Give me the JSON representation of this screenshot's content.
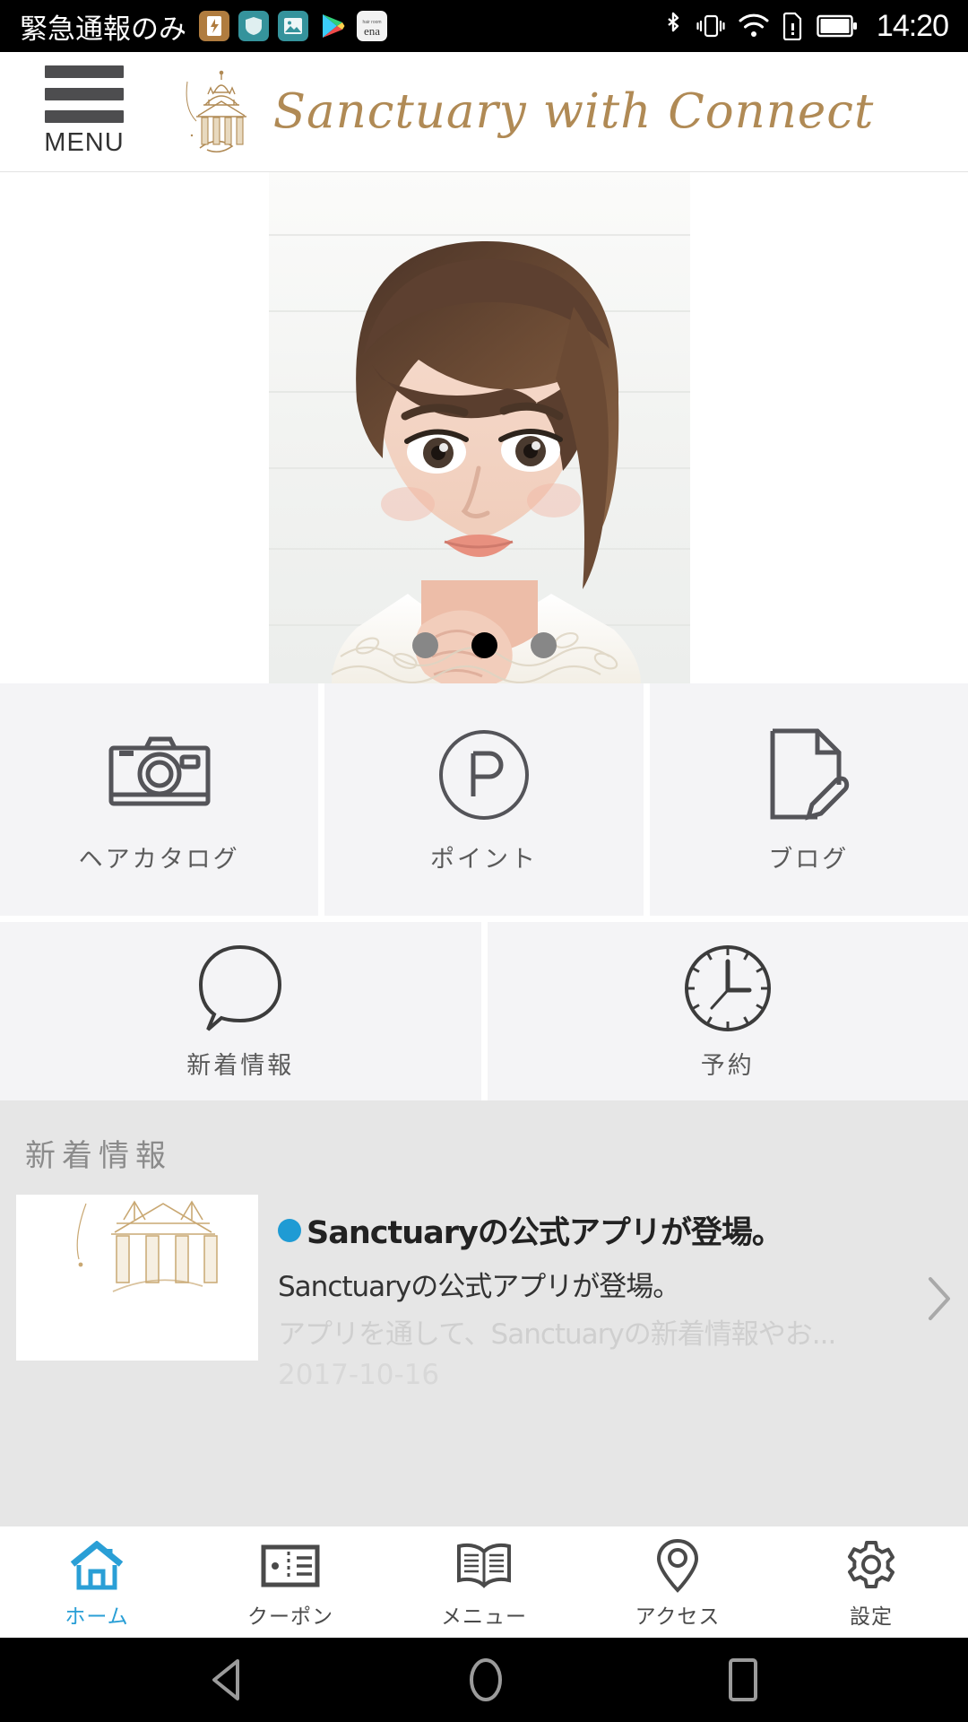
{
  "statusbar": {
    "carrier": "緊急通報のみ",
    "time": "14:20",
    "left_icons": [
      "battery-saver-icon",
      "shield-icon",
      "gallery-icon",
      "play-store-icon",
      "ena-app-icon"
    ],
    "right_icons": [
      "bluetooth-icon",
      "vibrate-icon",
      "wifi-icon",
      "sd-card-icon",
      "battery-icon"
    ]
  },
  "header": {
    "menu_label": "MENU",
    "logo_text": "Sanctuary with Connect",
    "logo_color": "#b08a55"
  },
  "hero": {
    "alt": "woman-with-short-brown-hair-portrait",
    "dots": [
      {
        "active": false
      },
      {
        "active": true
      },
      {
        "active": false
      }
    ]
  },
  "tiles": {
    "row1": [
      {
        "label": "ヘアカタログ",
        "icon": "camera-icon"
      },
      {
        "label": "ポイント",
        "icon": "point-p-circle-icon"
      },
      {
        "label": "ブログ",
        "icon": "document-pencil-icon"
      }
    ],
    "row2": [
      {
        "label": "新着情報",
        "icon": "speech-bubble-icon"
      },
      {
        "label": "予約",
        "icon": "clock-icon"
      }
    ]
  },
  "news": {
    "section_title": "新着情報",
    "items": [
      {
        "bullet_color": "#1f9bd4",
        "title": "Sanctuaryの公式アプリが登場。",
        "subtitle": "Sanctuaryの公式アプリが登場。",
        "subtitle2": "アプリを通して、Sanctuaryの新着情報やお...",
        "date": "2017-10-16",
        "thumb_alt": "sanctuary-temple-logo-thumbnail"
      }
    ]
  },
  "tabbar": {
    "active_color": "#2a9fd6",
    "items": [
      {
        "label": "ホーム",
        "icon": "home-icon",
        "active": true
      },
      {
        "label": "クーポン",
        "icon": "coupon-ticket-icon",
        "active": false
      },
      {
        "label": "メニュー",
        "icon": "open-book-icon",
        "active": false
      },
      {
        "label": "アクセス",
        "icon": "map-pin-icon",
        "active": false
      },
      {
        "label": "設定",
        "icon": "gear-icon",
        "active": false
      }
    ]
  },
  "navbar": {
    "back": "back-triangle-icon",
    "home": "home-circle-icon",
    "recents": "recents-square-icon"
  }
}
